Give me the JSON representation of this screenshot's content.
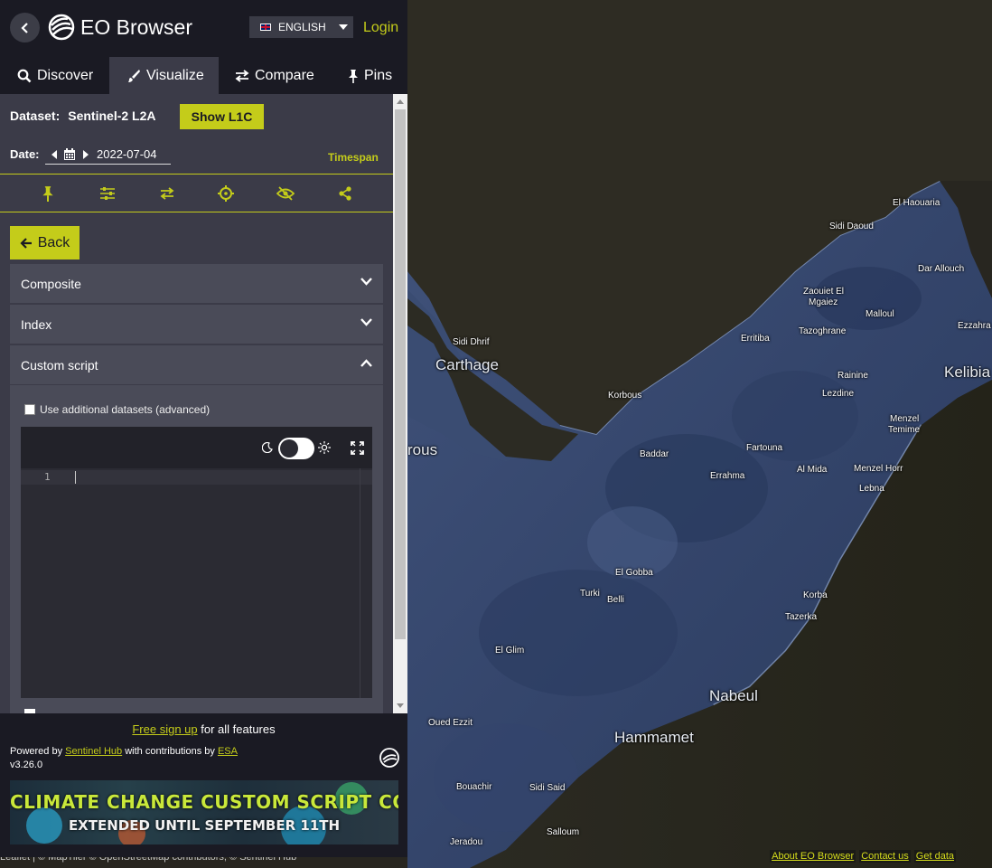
{
  "header": {
    "brand": "EO Browser",
    "language": "ENGLISH",
    "login": "Login"
  },
  "tabs": [
    {
      "label": "Discover",
      "icon": "search-icon",
      "active": false
    },
    {
      "label": "Visualize",
      "icon": "brush-icon",
      "active": true
    },
    {
      "label": "Compare",
      "icon": "compare-icon",
      "active": false
    },
    {
      "label": "Pins",
      "icon": "pin-icon",
      "active": false
    }
  ],
  "visualize": {
    "dataset_label": "Dataset:",
    "dataset_value": "Sentinel-2 L2A",
    "show_l1c": "Show L1C",
    "date_label": "Date:",
    "date_value": "2022-07-04",
    "timespan": "Timespan",
    "toolbar_icons": [
      "pin-icon",
      "sliders-icon",
      "compare-icon",
      "crosshair-icon",
      "eye-off-icon",
      "share-icon"
    ],
    "back": "Back",
    "accordions": [
      {
        "label": "Composite",
        "open": false
      },
      {
        "label": "Index",
        "open": false
      },
      {
        "label": "Custom script",
        "open": true
      }
    ],
    "use_additional": "Use additional datasets (advanced)",
    "editor_line": "1"
  },
  "footer": {
    "signup_link": "Free sign up",
    "signup_rest": " for all features",
    "powered_prefix": "Powered by ",
    "powered_link": "Sentinel Hub",
    "powered_mid": " with contributions by ",
    "esa_link": "ESA",
    "version": "v3.26.0",
    "banner_line1": "CLIMATE CHANGE CUSTOM SCRIPT CONTEST",
    "banner_line2": "EXTENDED UNTIL SEPTEMBER 11TH"
  },
  "map": {
    "places": [
      {
        "name": "El Haouaria",
        "big": false
      },
      {
        "name": "Sidi Daoud",
        "big": false
      },
      {
        "name": "Dar Allouch",
        "big": false
      },
      {
        "name": "Zaouiet El",
        "big": false
      },
      {
        "name": "Mgaiez",
        "big": false
      },
      {
        "name": "Malloul",
        "big": false
      },
      {
        "name": "Ezzahra",
        "big": false
      },
      {
        "name": "Sidi Dhrif",
        "big": false
      },
      {
        "name": "Carthage",
        "big": true
      },
      {
        "name": "Erritiba",
        "big": false
      },
      {
        "name": "Tazoghrane",
        "big": false
      },
      {
        "name": "Kelibia",
        "big": true
      },
      {
        "name": "Rainine",
        "big": false
      },
      {
        "name": "Korbous",
        "big": false
      },
      {
        "name": "Lezdine",
        "big": false
      },
      {
        "name": "Menzel",
        "big": false
      },
      {
        "name": "Temime",
        "big": false
      },
      {
        "name": "rous",
        "big": true
      },
      {
        "name": "Fartouna",
        "big": false
      },
      {
        "name": "Baddar",
        "big": false
      },
      {
        "name": "Al Mida",
        "big": false
      },
      {
        "name": "Menzel Horr",
        "big": false
      },
      {
        "name": "Errahma",
        "big": false
      },
      {
        "name": "Lebna",
        "big": false
      },
      {
        "name": "El Gobba",
        "big": false
      },
      {
        "name": "Turki",
        "big": false
      },
      {
        "name": "Belli",
        "big": false
      },
      {
        "name": "Korba",
        "big": false
      },
      {
        "name": "Tazerka",
        "big": false
      },
      {
        "name": "El Glim",
        "big": false
      },
      {
        "name": "Nabeul",
        "big": true
      },
      {
        "name": "Oued Ezzit",
        "big": false
      },
      {
        "name": "Hammamet",
        "big": true
      },
      {
        "name": "Bouachir",
        "big": false
      },
      {
        "name": "Sidi Said",
        "big": false
      },
      {
        "name": "Salloum",
        "big": false
      },
      {
        "name": "Jeradou",
        "big": false
      }
    ],
    "attribution": "Leaflet | © MapTiler © OpenStreetMap contributors, © Sentinel Hub",
    "links": [
      "About EO Browser",
      "Contact us",
      "Get data"
    ]
  }
}
